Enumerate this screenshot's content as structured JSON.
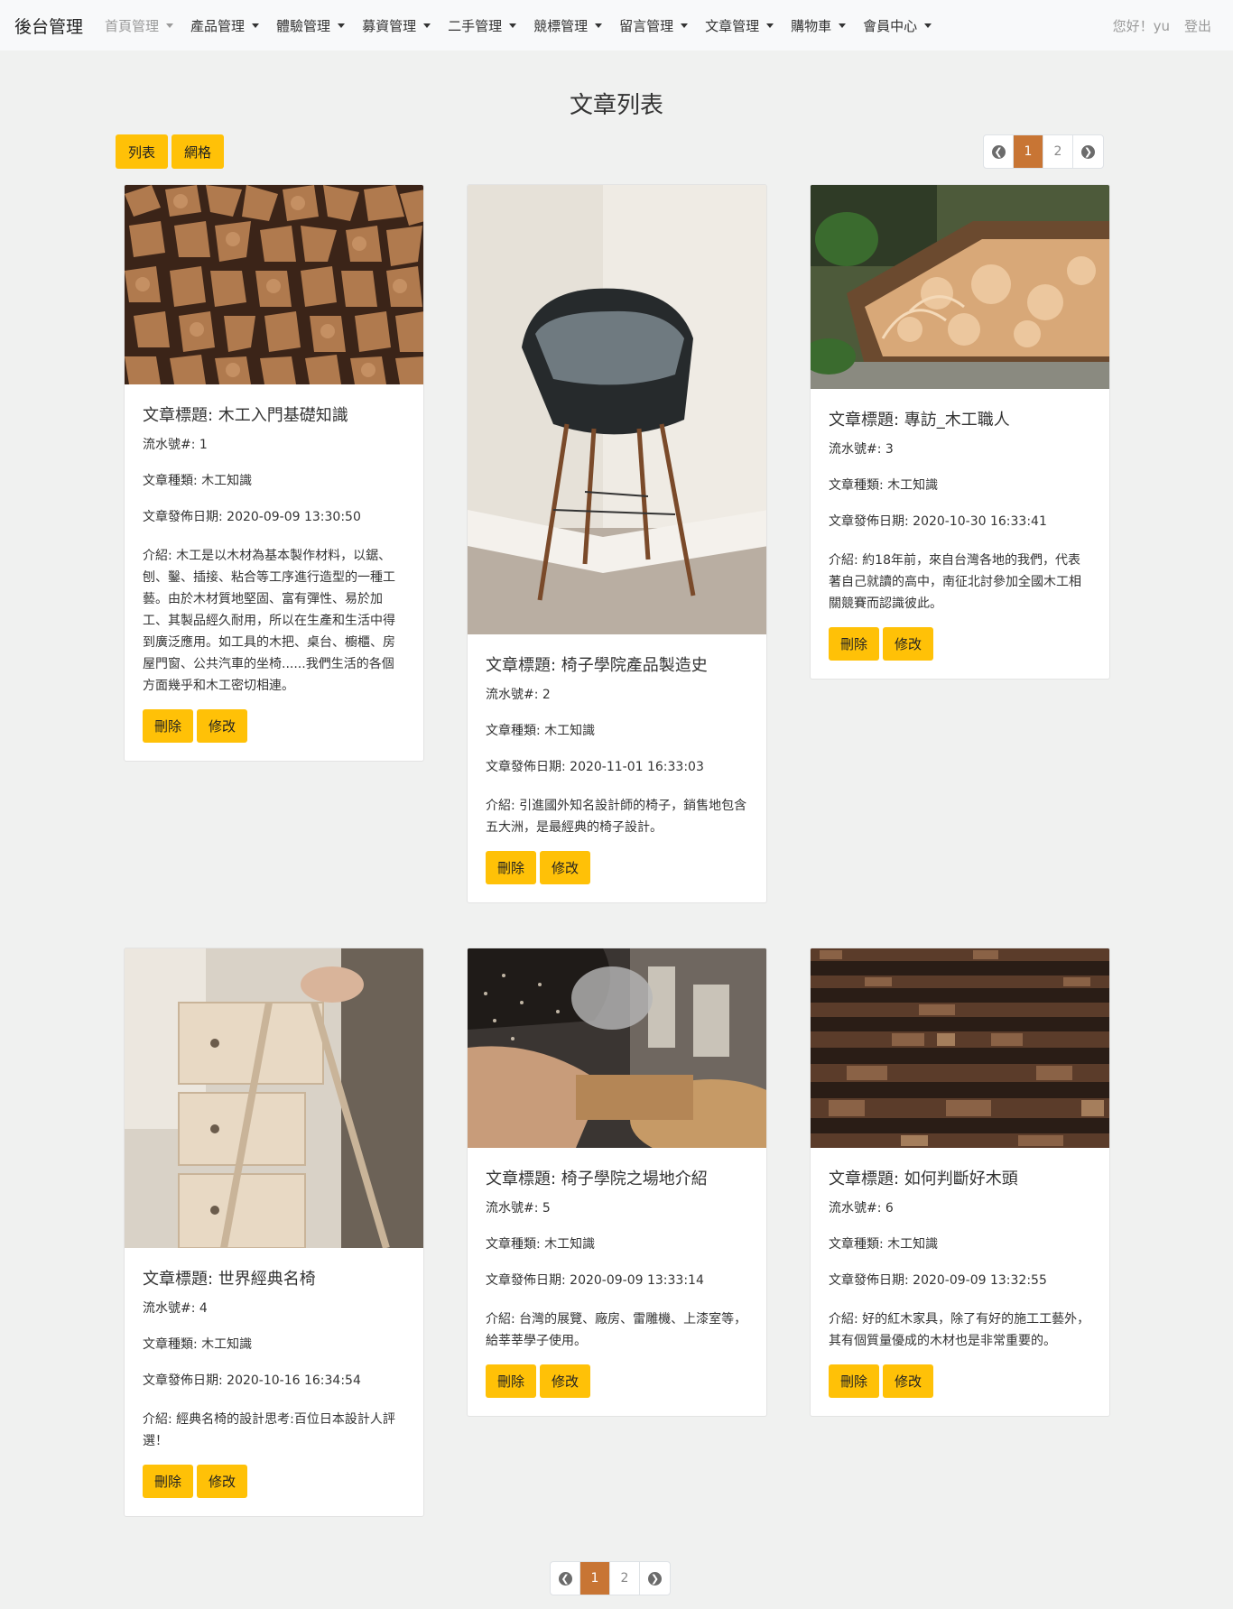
{
  "navbar": {
    "brand": "後台管理",
    "menu": [
      {
        "label": "首頁管理",
        "muted": true
      },
      {
        "label": "產品管理",
        "muted": false
      },
      {
        "label": "體驗管理",
        "muted": false
      },
      {
        "label": "募資管理",
        "muted": false
      },
      {
        "label": "二手管理",
        "muted": false
      },
      {
        "label": "競標管理",
        "muted": false
      },
      {
        "label": "留言管理",
        "muted": false
      },
      {
        "label": "文章管理",
        "muted": false
      },
      {
        "label": "購物車",
        "muted": false
      },
      {
        "label": "會員中心",
        "muted": false
      }
    ],
    "greeting": "您好！yu",
    "logout": "登出"
  },
  "page": {
    "title": "文章列表",
    "view_list": "列表",
    "view_grid": "網格"
  },
  "pagination": {
    "prev_icon": "arrow-left-circle",
    "next_icon": "arrow-right-circle",
    "pages": [
      "1",
      "2"
    ],
    "current": "1"
  },
  "labels": {
    "title_prefix": "文章標題: ",
    "serial_prefix": "流水號#: ",
    "category_prefix": "文章種類: ",
    "date_prefix": "文章發佈日期: ",
    "intro_prefix": "介紹: ",
    "delete": "刪除",
    "edit": "修改"
  },
  "articles": [
    {
      "title": "木工入門基礎知識",
      "serial": "1",
      "category": "木工知識",
      "date": "2020-09-09 13:30:50",
      "intro": "木工是以木材為基本製作材料，以鋸、刨、鑿、插接、粘合等工序進行造型的一種工藝。由於木材質地堅固、富有彈性、易於加工、其製品經久耐用，所以在生產和生活中得到廣泛應用。如工具的木把、桌台、櫥櫃、房屋門窗、公共汽車的坐椅......我們生活的各個方面幾乎和木工密切相連。",
      "image": "stacked-firewood-logs"
    },
    {
      "title": "椅子學院產品製造史",
      "serial": "2",
      "category": "木工知識",
      "date": "2020-11-01 16:33:03",
      "intro": "引進國外知名設計師的椅子，銷售地包含五大洲，是最經典的椅子設計。",
      "image": "black-chair-with-cushion"
    },
    {
      "title": "專訪_木工職人",
      "serial": "3",
      "category": "木工知識",
      "date": "2020-10-30 16:33:41",
      "intro": "約18年前，來自台灣各地的我們，代表著自己就讀的高中，南征北討參加全國木工相關競賽而認識彼此。",
      "image": "wood-shavings-in-box"
    },
    {
      "title": "世界經典名椅",
      "serial": "4",
      "category": "木工知識",
      "date": "2020-10-16 16:34:54",
      "intro": "經典名椅的設計思考:百位日本設計人評選！",
      "image": "wooden-drawer-furniture"
    },
    {
      "title": "椅子學院之場地介紹",
      "serial": "5",
      "category": "木工知識",
      "date": "2020-09-09 13:33:14",
      "intro": "台灣的展覽、廠房、雷雕機、上漆室等，給莘莘學子使用。",
      "image": "woodworker-at-lathe"
    },
    {
      "title": "如何判斷好木頭",
      "serial": "6",
      "category": "木工知識",
      "date": "2020-09-09 13:32:55",
      "intro": "好的紅木家具，除了有好的施工工藝外，其有個質量優成的木材也是非常重要的。",
      "image": "stacked-lumber-planks"
    }
  ]
}
